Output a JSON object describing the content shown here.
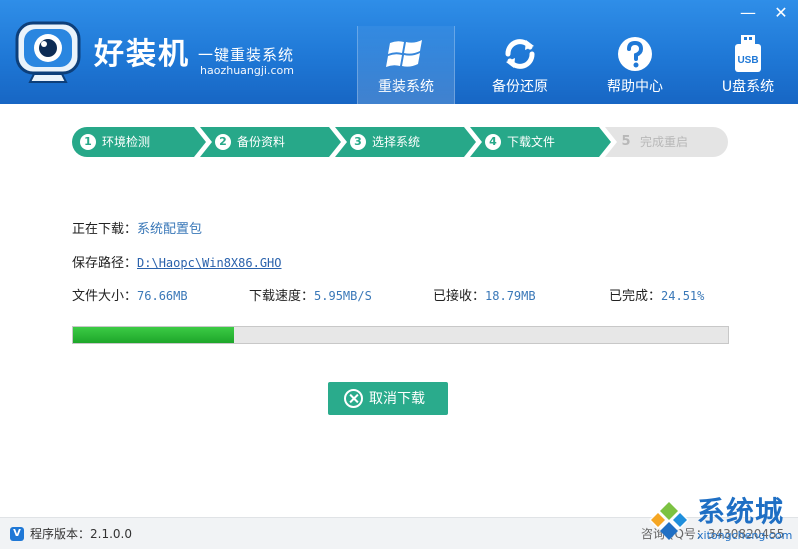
{
  "app": {
    "brand": "好装机",
    "slogan": "一键重装系统",
    "domain": "haozhuangji.com",
    "accent_color": "#1f78d6",
    "step_color": "#27a889",
    "logo_icon": "monitor-eye-icon"
  },
  "window_controls": {
    "minimize": "—",
    "close": "✕"
  },
  "nav": [
    {
      "label": "重装系统",
      "icon": "windows-logo-icon",
      "active": true
    },
    {
      "label": "备份还原",
      "icon": "sync-arrows-icon",
      "active": false
    },
    {
      "label": "帮助中心",
      "icon": "question-icon",
      "active": false
    },
    {
      "label": "U盘系统",
      "icon": "usb-drive-icon",
      "badge": "USB",
      "active": false
    }
  ],
  "steps": [
    {
      "num": "1",
      "label": "环境检测",
      "state": "done"
    },
    {
      "num": "2",
      "label": "备份资料",
      "state": "done"
    },
    {
      "num": "3",
      "label": "选择系统",
      "state": "done"
    },
    {
      "num": "4",
      "label": "下载文件",
      "state": "current"
    },
    {
      "num": "5",
      "label": "完成重启",
      "state": "pending"
    }
  ],
  "download": {
    "downloading_label": "正在下载：",
    "downloading_value": "系统配置包",
    "path_label": "保存路径：",
    "path_value": "D:\\Haopc\\Win8X86.GHO",
    "size_label": "文件大小：",
    "size_value": "76.66MB",
    "speed_label": "下载速度：",
    "speed_value": "5.95MB/S",
    "received_label": "已接收：",
    "received_value": "18.79MB",
    "done_label": "已完成：",
    "done_value": "24.51%",
    "progress_fraction": 0.2451
  },
  "cancel_label": "取消下载",
  "footer": {
    "version_badge": "V",
    "version_text": "程序版本：2.1.0.0",
    "qq_text": "咨询QQ号：3430820455"
  },
  "watermark": {
    "cn": "系统城",
    "url": "xitongcheng.com"
  }
}
